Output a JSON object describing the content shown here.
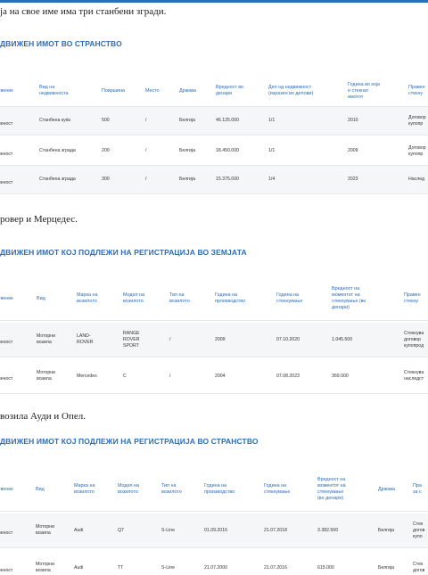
{
  "intro1": "ја на свое име има три станбени згради.",
  "heading1": "ДВИЖЕН ИМОТ ВО СТРАНСТВО",
  "table1": {
    "headers": [
      "твеник",
      "Вид на\nнедвижноста",
      "Површина",
      "Место",
      "Држава",
      "Вредност во\nденари",
      "Дел од недвижност\n(изразен во делови)",
      "Година во која\nе стекнат\nимотот",
      "Правен\nстекну"
    ],
    "rows": [
      [
        "\nвеност",
        "Станбена куќа",
        "500",
        "/",
        "Белгија",
        "46.125.000",
        "1/1",
        "2010",
        "Договор\nкупопр"
      ],
      [
        "\nвеност",
        "Станбена зграда",
        "200",
        "/",
        "Белгија",
        "18.450.000",
        "1/1",
        "2009",
        "Договор\nкупопр"
      ],
      [
        "\nвеност",
        "Станбена зграда",
        "300",
        "/",
        "Белгија",
        "15.375.000",
        "1/4",
        "2023",
        "Наслед"
      ]
    ]
  },
  "intro2": "ровер и Мерцедес.",
  "heading2": "ДВИЖЕН ИМОТ КОЈ ПОДЛЕЖИ НА РЕГИСТРАЦИЈА ВО ЗЕМЈАТА",
  "table2": {
    "headers": [
      "твеник",
      "Вид",
      "Марка на\nвозилото",
      "Модел на\nвозилото",
      "Тип на\nвозилото",
      "Година на\nпроизводство",
      "Година на\nстекнување",
      "Вредност на\nмоментот на\nстекнување (во\nденари)",
      "Правен\nстекну"
    ],
    "rows": [
      [
        "\nвеност",
        "Моторни\nвозила",
        "LAND-\nROVER",
        "RANGE\nROVER\nSPORT",
        "/",
        "2009",
        "07.10.2020",
        "1.045.500",
        "Стекнува\nдоговор\nкупопрод"
      ],
      [
        "\nвеност",
        "Моторни\nвозила",
        "Mercedes",
        "C",
        "/",
        "2004",
        "07.08.2023",
        "369.000",
        "Стекнува\nнаследст"
      ]
    ]
  },
  "intro3": "возила Ауди и Опел.",
  "heading3": "ДВИЖЕН ИМОТ КОЈ ПОДЛЕЖИ НА РЕГИСТРАЦИЈА ВО СТРАНСТВО",
  "table3": {
    "headers": [
      "твеник",
      "Вид",
      "Марка на\nвозилото",
      "Модел на\nвозилото",
      "Тип на\nвозилото",
      "Година на\nпроизводство",
      "Година на\nстекнување",
      "Вредност на\nмоментот на\nстекнување\n(во денари)",
      "Држава",
      "Пра\nза с"
    ],
    "rows": [
      [
        "\nвеност",
        "Моторни\nвозила",
        "Audi",
        "Q7",
        "S-Line",
        "01.09.2016",
        "21.07.2018",
        "3.382.500",
        "Белгија",
        "Стек\nдогов\nкупо"
      ],
      [
        "\nвеност",
        "Моторни\nвозила",
        "Audi",
        "TT",
        "S-Line",
        "21.07.2000",
        "21.07.2016",
        "615.000",
        "Белгија",
        "Стек\nдогов"
      ]
    ]
  }
}
